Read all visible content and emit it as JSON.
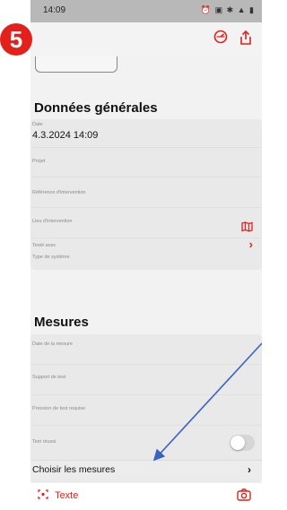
{
  "status": {
    "time": "14:09",
    "icons": "⏰ ▣ ✱ ▲ ▮"
  },
  "badge": {
    "number": "5"
  },
  "appbar": {
    "gauge_icon": "gauge-icon",
    "share_icon": "share-icon"
  },
  "general": {
    "title": "Données générales",
    "date_label": "Date",
    "date_value": "4.3.2024 14:09",
    "fields": {
      "projet": "Projet",
      "reference": "Référence d'intervention",
      "lieu": "Lieu d'intervention",
      "teste_avec": "Testé avec",
      "type_systeme": "Type de système"
    }
  },
  "mesures": {
    "title": "Mesures",
    "date_mesure": "Date de la mesure",
    "support": "Support de test",
    "pression": "Pression de test requise",
    "test_reussi": "Test réussi",
    "test_reussi_on": false,
    "choisir": "Choisir les mesures"
  },
  "bottom": {
    "texte": "Texte"
  },
  "colors": {
    "accent": "#e3201b",
    "annotation": "#3a62c2"
  }
}
